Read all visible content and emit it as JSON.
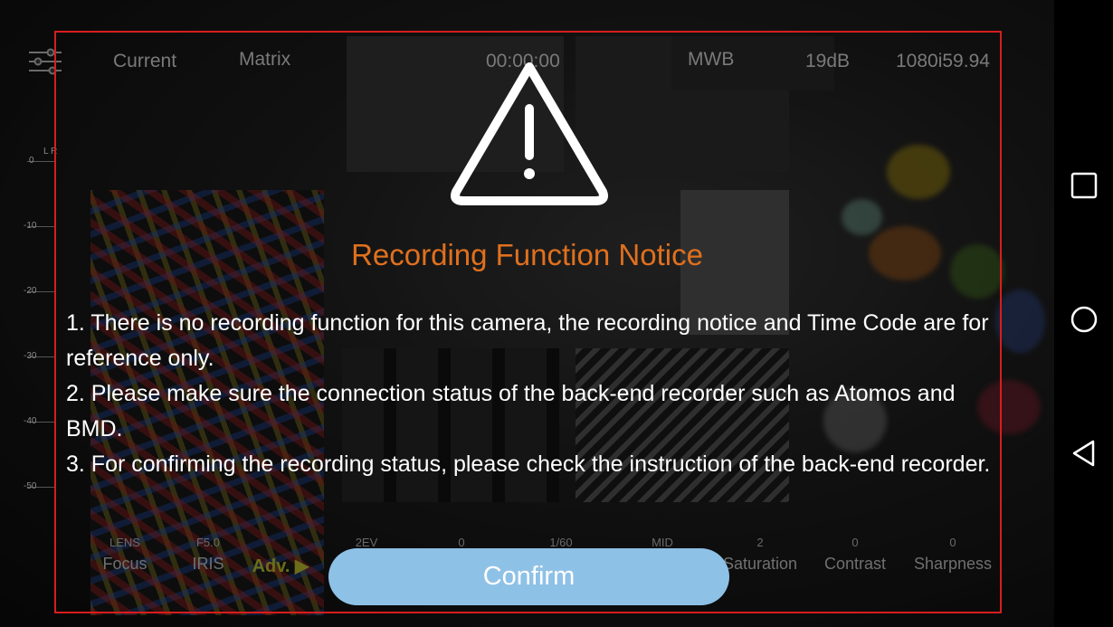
{
  "status_bar": {
    "mode": "Current",
    "matrix": "Matrix",
    "timecode": "00:00:00",
    "white_balance": "MWB",
    "gain": "19dB",
    "format": "1080i59.94"
  },
  "audio_meter": {
    "channels": "L R",
    "ticks": [
      "0",
      "-10",
      "-20",
      "-30",
      "-40",
      "-50"
    ]
  },
  "controls": [
    {
      "value": "LENS",
      "label": "Focus"
    },
    {
      "value": "F5.0",
      "label": "IRIS"
    },
    {
      "value": "",
      "label": "Adv. ▶"
    },
    {
      "value": "2EV",
      "label": ""
    },
    {
      "value": "0",
      "label": ""
    },
    {
      "value": "1/60",
      "label": ""
    },
    {
      "value": "MID",
      "label": ""
    },
    {
      "value": "2",
      "label": "Saturation"
    },
    {
      "value": "0",
      "label": "Contrast"
    },
    {
      "value": "0",
      "label": "Sharpness"
    }
  ],
  "dialog": {
    "title": "Recording Function Notice",
    "items": [
      "1. There is no recording function for this camera, the recording notice and Time Code are for reference only.",
      "2. Please make sure the connection status of the back-end recorder such as Atomos and BMD.",
      "3. For confirming the recording status, please check the instruction of the back-end recorder."
    ],
    "confirm_label": "Confirm"
  },
  "icons": {
    "warning": "warning-triangle-icon",
    "settings": "sliders-icon",
    "recents": "square-icon",
    "home": "circle-icon",
    "back": "triangle-back-icon"
  },
  "colors": {
    "title": "#e0701e",
    "confirm_button": "#8ec1e6",
    "frame": "#d81d1d"
  }
}
